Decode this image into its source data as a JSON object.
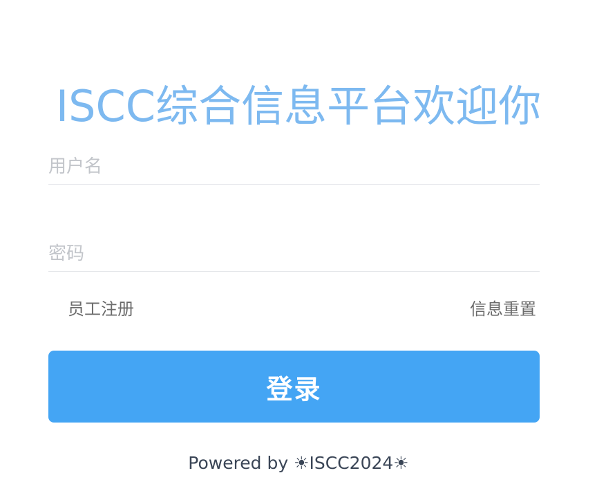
{
  "header": {
    "title": "ISCC综合信息平台欢迎你"
  },
  "form": {
    "username_placeholder": "用户名",
    "password_placeholder": "密码",
    "register_label": "员工注册",
    "reset_label": "信息重置",
    "login_label": "登录"
  },
  "footer": {
    "text": "Powered by ☀ISCC2024☀"
  },
  "colors": {
    "title": "#7db9f0",
    "button": "#44a5f4",
    "link": "#6b6b6b",
    "footer": "#3a4556"
  }
}
